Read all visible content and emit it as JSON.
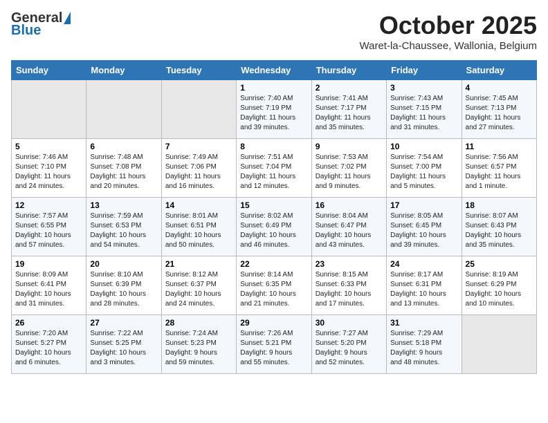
{
  "logo": {
    "general": "General",
    "blue": "Blue"
  },
  "header": {
    "month": "October 2025",
    "location": "Waret-la-Chaussee, Wallonia, Belgium"
  },
  "days_of_week": [
    "Sunday",
    "Monday",
    "Tuesday",
    "Wednesday",
    "Thursday",
    "Friday",
    "Saturday"
  ],
  "weeks": [
    [
      {
        "day": "",
        "info": ""
      },
      {
        "day": "",
        "info": ""
      },
      {
        "day": "",
        "info": ""
      },
      {
        "day": "1",
        "info": "Sunrise: 7:40 AM\nSunset: 7:19 PM\nDaylight: 11 hours\nand 39 minutes."
      },
      {
        "day": "2",
        "info": "Sunrise: 7:41 AM\nSunset: 7:17 PM\nDaylight: 11 hours\nand 35 minutes."
      },
      {
        "day": "3",
        "info": "Sunrise: 7:43 AM\nSunset: 7:15 PM\nDaylight: 11 hours\nand 31 minutes."
      },
      {
        "day": "4",
        "info": "Sunrise: 7:45 AM\nSunset: 7:13 PM\nDaylight: 11 hours\nand 27 minutes."
      }
    ],
    [
      {
        "day": "5",
        "info": "Sunrise: 7:46 AM\nSunset: 7:10 PM\nDaylight: 11 hours\nand 24 minutes."
      },
      {
        "day": "6",
        "info": "Sunrise: 7:48 AM\nSunset: 7:08 PM\nDaylight: 11 hours\nand 20 minutes."
      },
      {
        "day": "7",
        "info": "Sunrise: 7:49 AM\nSunset: 7:06 PM\nDaylight: 11 hours\nand 16 minutes."
      },
      {
        "day": "8",
        "info": "Sunrise: 7:51 AM\nSunset: 7:04 PM\nDaylight: 11 hours\nand 12 minutes."
      },
      {
        "day": "9",
        "info": "Sunrise: 7:53 AM\nSunset: 7:02 PM\nDaylight: 11 hours\nand 9 minutes."
      },
      {
        "day": "10",
        "info": "Sunrise: 7:54 AM\nSunset: 7:00 PM\nDaylight: 11 hours\nand 5 minutes."
      },
      {
        "day": "11",
        "info": "Sunrise: 7:56 AM\nSunset: 6:57 PM\nDaylight: 11 hours\nand 1 minute."
      }
    ],
    [
      {
        "day": "12",
        "info": "Sunrise: 7:57 AM\nSunset: 6:55 PM\nDaylight: 10 hours\nand 57 minutes."
      },
      {
        "day": "13",
        "info": "Sunrise: 7:59 AM\nSunset: 6:53 PM\nDaylight: 10 hours\nand 54 minutes."
      },
      {
        "day": "14",
        "info": "Sunrise: 8:01 AM\nSunset: 6:51 PM\nDaylight: 10 hours\nand 50 minutes."
      },
      {
        "day": "15",
        "info": "Sunrise: 8:02 AM\nSunset: 6:49 PM\nDaylight: 10 hours\nand 46 minutes."
      },
      {
        "day": "16",
        "info": "Sunrise: 8:04 AM\nSunset: 6:47 PM\nDaylight: 10 hours\nand 43 minutes."
      },
      {
        "day": "17",
        "info": "Sunrise: 8:05 AM\nSunset: 6:45 PM\nDaylight: 10 hours\nand 39 minutes."
      },
      {
        "day": "18",
        "info": "Sunrise: 8:07 AM\nSunset: 6:43 PM\nDaylight: 10 hours\nand 35 minutes."
      }
    ],
    [
      {
        "day": "19",
        "info": "Sunrise: 8:09 AM\nSunset: 6:41 PM\nDaylight: 10 hours\nand 31 minutes."
      },
      {
        "day": "20",
        "info": "Sunrise: 8:10 AM\nSunset: 6:39 PM\nDaylight: 10 hours\nand 28 minutes."
      },
      {
        "day": "21",
        "info": "Sunrise: 8:12 AM\nSunset: 6:37 PM\nDaylight: 10 hours\nand 24 minutes."
      },
      {
        "day": "22",
        "info": "Sunrise: 8:14 AM\nSunset: 6:35 PM\nDaylight: 10 hours\nand 21 minutes."
      },
      {
        "day": "23",
        "info": "Sunrise: 8:15 AM\nSunset: 6:33 PM\nDaylight: 10 hours\nand 17 minutes."
      },
      {
        "day": "24",
        "info": "Sunrise: 8:17 AM\nSunset: 6:31 PM\nDaylight: 10 hours\nand 13 minutes."
      },
      {
        "day": "25",
        "info": "Sunrise: 8:19 AM\nSunset: 6:29 PM\nDaylight: 10 hours\nand 10 minutes."
      }
    ],
    [
      {
        "day": "26",
        "info": "Sunrise: 7:20 AM\nSunset: 5:27 PM\nDaylight: 10 hours\nand 6 minutes."
      },
      {
        "day": "27",
        "info": "Sunrise: 7:22 AM\nSunset: 5:25 PM\nDaylight: 10 hours\nand 3 minutes."
      },
      {
        "day": "28",
        "info": "Sunrise: 7:24 AM\nSunset: 5:23 PM\nDaylight: 9 hours\nand 59 minutes."
      },
      {
        "day": "29",
        "info": "Sunrise: 7:26 AM\nSunset: 5:21 PM\nDaylight: 9 hours\nand 55 minutes."
      },
      {
        "day": "30",
        "info": "Sunrise: 7:27 AM\nSunset: 5:20 PM\nDaylight: 9 hours\nand 52 minutes."
      },
      {
        "day": "31",
        "info": "Sunrise: 7:29 AM\nSunset: 5:18 PM\nDaylight: 9 hours\nand 48 minutes."
      },
      {
        "day": "",
        "info": ""
      }
    ]
  ]
}
